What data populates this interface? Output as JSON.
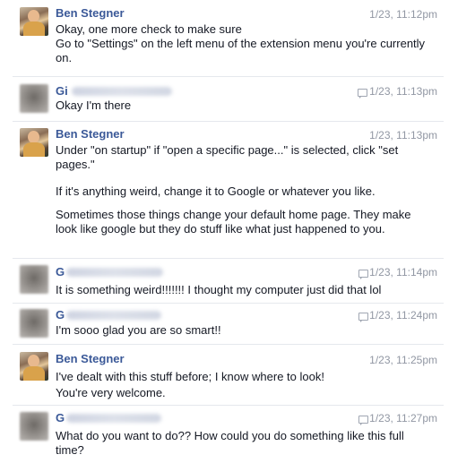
{
  "messages": [
    {
      "sender": "Ben Stegner",
      "time": "1/23, 11:12pm",
      "paragraphs": [
        "Okay, one more check to make sure\nGo to \"Settings\" on the left menu of the extension menu you're currently on."
      ]
    },
    {
      "sender": "Gi",
      "time": "1/23, 11:13pm",
      "paragraphs": [
        "Okay I'm there"
      ]
    },
    {
      "sender": "Ben Stegner",
      "time": "1/23, 11:13pm",
      "paragraphs": [
        "Under \"on startup\" if \"open a specific page...\" is selected, click \"set pages.\"",
        "If it's anything weird, change it to Google or whatever you like.",
        "Sometimes those things change your default home page. They make look like google but they do stuff like what just happened to you."
      ]
    },
    {
      "sender": "G",
      "time": "1/23, 11:14pm",
      "paragraphs": [
        "It is something weird!!!!!!! I thought my computer just did that lol"
      ]
    },
    {
      "sender": "G",
      "time": "1/23, 11:24pm",
      "paragraphs": [
        "I'm sooo glad you are so smart!!"
      ]
    },
    {
      "sender": "Ben Stegner",
      "time": "1/23, 11:25pm",
      "paragraphs": [
        "I've dealt with this stuff before; I know where to look!\nYou're very welcome."
      ]
    },
    {
      "sender": "G",
      "time": "1/23, 11:27pm",
      "paragraphs": [
        "What do you want to do?? How could you do something like this full time?"
      ]
    }
  ]
}
